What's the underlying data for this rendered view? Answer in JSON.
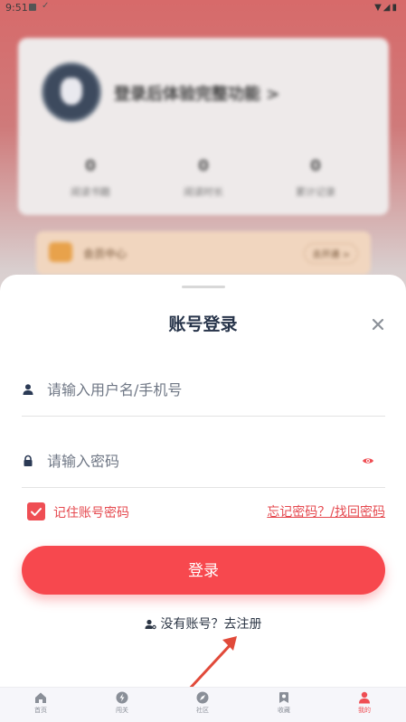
{
  "status_bar": {
    "time": "9:51"
  },
  "background": {
    "login_hint": "登录后体验完整功能 >",
    "stats": [
      {
        "value": "0",
        "label": "阅读书籍"
      },
      {
        "value": "0",
        "label": "阅读时长"
      },
      {
        "value": "0",
        "label": "累计记录"
      }
    ],
    "vip": {
      "title": "会员中心",
      "button": "去开通 >"
    }
  },
  "login_sheet": {
    "title": "账号登录",
    "username": {
      "placeholder": "请输入用户名/手机号",
      "value": ""
    },
    "password": {
      "placeholder": "请输入密码",
      "value": ""
    },
    "remember_label": "记住账号密码",
    "remember_checked": true,
    "forgot_link": "忘记密码？/找回密码",
    "login_button": "登录",
    "register_text": "没有账号？去注册"
  },
  "tabbar": {
    "items": [
      {
        "label": "首页",
        "icon": "home-icon",
        "active": false
      },
      {
        "label": "闯关",
        "icon": "lightning-icon",
        "active": false
      },
      {
        "label": "社区",
        "icon": "compass-icon",
        "active": false
      },
      {
        "label": "收藏",
        "icon": "bookmark-icon",
        "active": false
      },
      {
        "label": "我的",
        "icon": "user-icon",
        "active": true
      }
    ]
  },
  "colors": {
    "accent": "#f7484e",
    "title": "#27344a",
    "link": "#e5484e"
  }
}
